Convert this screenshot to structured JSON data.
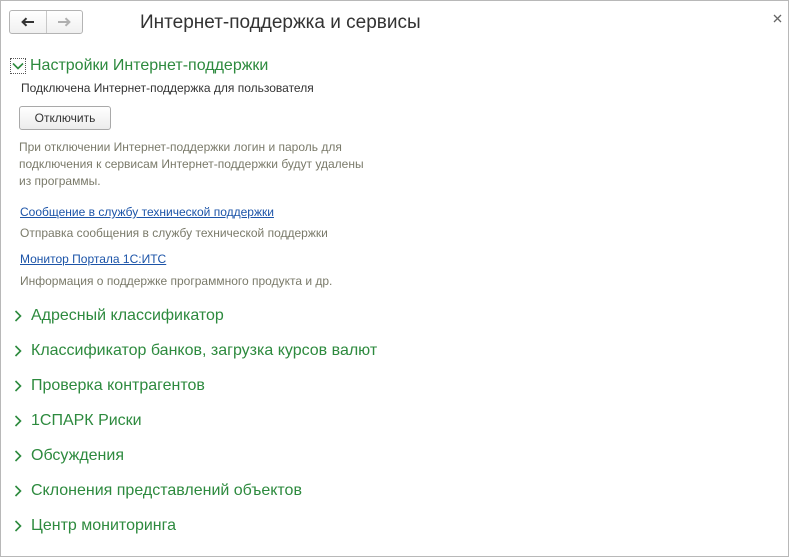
{
  "window": {
    "title": "Интернет-поддержка и сервисы"
  },
  "icons": {
    "back": "arrow-left-icon",
    "forward": "arrow-right-icon",
    "close": "close-icon",
    "expanded": "chevron-down-icon",
    "collapsed": "chevron-right-icon"
  },
  "colors": {
    "section_header": "#2d8a3e",
    "link": "#1c54a8",
    "note": "#7a7a6a"
  },
  "support_settings": {
    "header": "Настройки Интернет-поддержки",
    "status": "Подключена Интернет-поддержка для пользователя",
    "disconnect_button": "Отключить",
    "note": "При отключении Интернет-поддержки логин и пароль для подключения к сервисам Интернет-поддержки будут удалены из программы.",
    "links": [
      {
        "label": "Сообщение в службу технической поддержки",
        "description": "Отправка сообщения в службу технической поддержки"
      },
      {
        "label": "Монитор Портала 1С:ИТС",
        "description": "Информация о поддержке программного продукта и др."
      }
    ]
  },
  "sections": [
    {
      "label": "Адресный классификатор"
    },
    {
      "label": "Классификатор банков, загрузка курсов валют"
    },
    {
      "label": "Проверка контрагентов"
    },
    {
      "label": "1СПАРК Риски"
    },
    {
      "label": "Обсуждения"
    },
    {
      "label": "Склонения представлений объектов"
    },
    {
      "label": "Центр мониторинга"
    }
  ]
}
